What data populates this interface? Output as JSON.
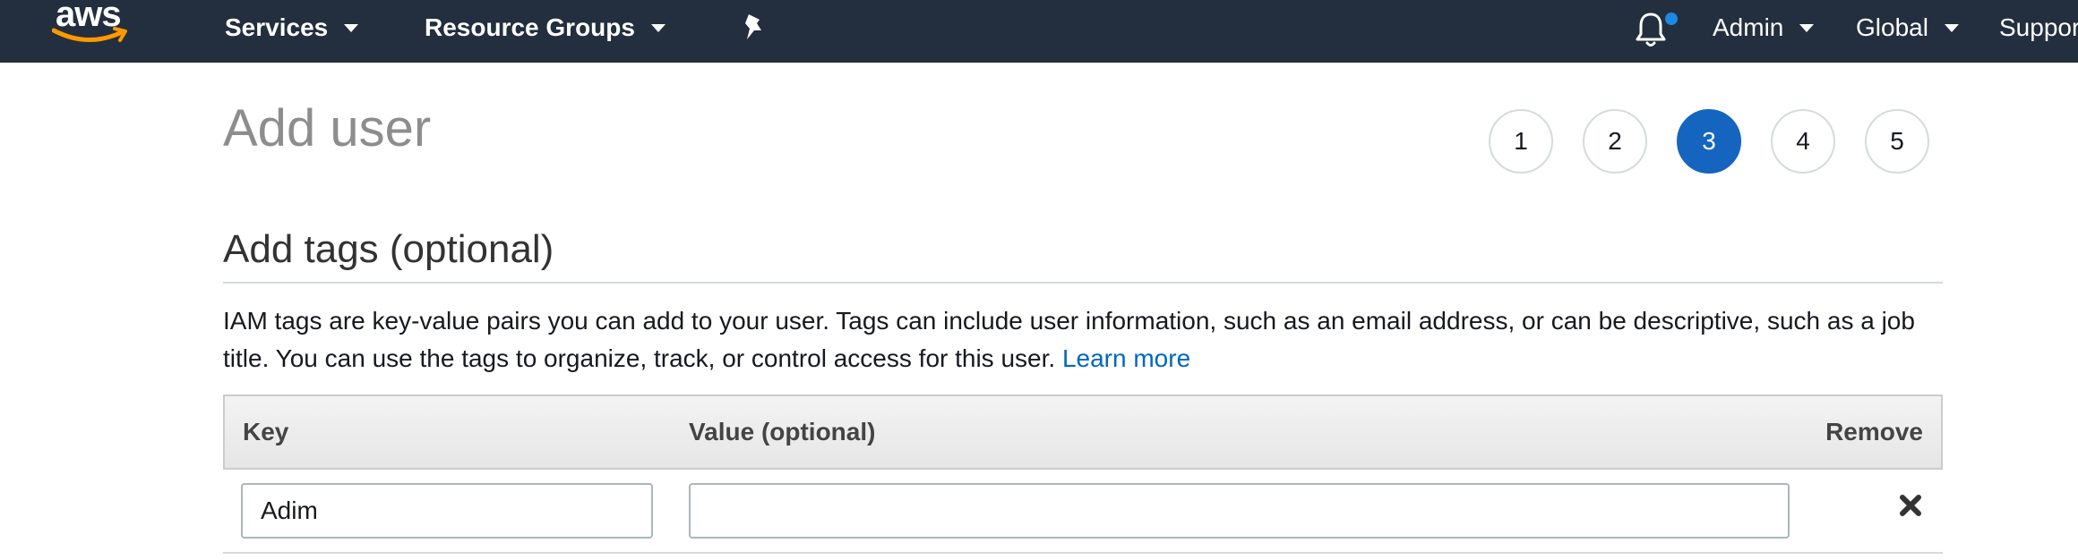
{
  "nav": {
    "logo": "aws",
    "services": "Services",
    "resource_groups": "Resource Groups",
    "user": "Admin",
    "region": "Global",
    "support": "Support",
    "icons": [
      "pin-icon",
      "bell-icon"
    ],
    "notification_color": "#1e88e5"
  },
  "page": {
    "title": "Add user"
  },
  "steps": [
    "1",
    "2",
    "3",
    "4",
    "5"
  ],
  "active_step": "3",
  "section": {
    "title": "Add tags (optional)",
    "description": "IAM tags are key-value pairs you can add to your user. Tags can include user information, such as an email address, or can be descriptive, such as a job title. You can use the tags to organize, track, or control access for this user.",
    "learn_more": "Learn more"
  },
  "table": {
    "headers": {
      "key": "Key",
      "value": "Value (optional)",
      "remove": "Remove"
    },
    "rows": [
      {
        "key": "Adim",
        "value": ""
      }
    ]
  },
  "colors": {
    "nav_bg": "#232f3e",
    "accent": "#1565c0",
    "link": "#0066c0"
  }
}
